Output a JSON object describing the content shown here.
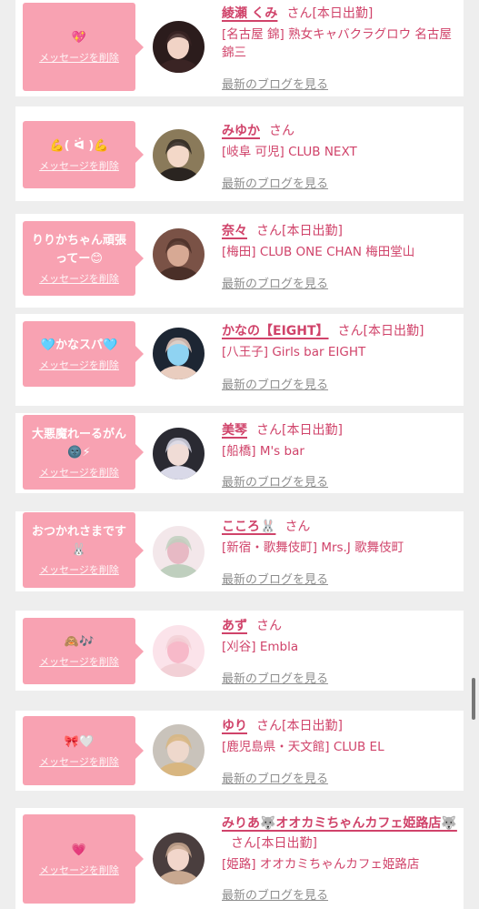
{
  "delete_label": "メッセージを削除",
  "blog_label": "最新のブログを見る",
  "colors": {
    "accent": "#d0436a",
    "bubble": "#f8a2b2",
    "background": "#eeeeee",
    "card": "#ffffff",
    "link_gray": "#8e8e8e"
  },
  "items": [
    {
      "message": "💖",
      "name": "綾瀬 くみ",
      "san": "さん",
      "status": "[本日出勤]",
      "shop": "[名古屋 錦] 熟女キャバクラグロウ 名古屋錦三",
      "avatar_icon": "profile-photo"
    },
    {
      "message": "💪(  ᐛ )💪",
      "name": "みゆか",
      "san": "さん",
      "status": "",
      "shop": "[岐阜 可児] CLUB NEXT",
      "avatar_icon": "profile-photo"
    },
    {
      "message": "りりかちゃん頑張ってー😊",
      "name": "奈々",
      "san": "さん",
      "status": "[本日出勤]",
      "shop": "[梅田] CLUB ONE CHAN 梅田堂山",
      "avatar_icon": "profile-photo"
    },
    {
      "message": "🩵かなスパ🩵",
      "name": "かなの【EIGHT】",
      "san": "さん",
      "status": "[本日出勤]",
      "shop": "[八王子] Girls bar EIGHT",
      "avatar_icon": "profile-photo"
    },
    {
      "message": "大悪魔れーるがん🌚⚡",
      "name": "美琴",
      "san": "さん",
      "status": "[本日出勤]",
      "shop": "[船橋] M's bar",
      "avatar_icon": "profile-photo"
    },
    {
      "message": "おつかれさまです🐰",
      "name": "こころ🐰",
      "san": "さん",
      "status": "",
      "shop": "[新宿・歌舞伎町] Mrs.J 歌舞伎町",
      "avatar_icon": "profile-photo"
    },
    {
      "message": "🙈🎶",
      "name": "あず",
      "san": "さん",
      "status": "",
      "shop": "[刈谷] Embla",
      "avatar_icon": "profile-photo"
    },
    {
      "message": "🎀🤍",
      "name": "ゆり",
      "san": "さん",
      "status": "[本日出勤]",
      "shop": "[鹿児島県・天文館] CLUB EL",
      "avatar_icon": "profile-photo"
    },
    {
      "message": "💗",
      "name": "みりあ🐺オオカミちゃんカフェ姫路店🐺",
      "san": "さん",
      "status": "[本日出勤]",
      "shop": "[姫路] オオカミちゃんカフェ姫路店",
      "avatar_icon": "profile-photo"
    }
  ]
}
